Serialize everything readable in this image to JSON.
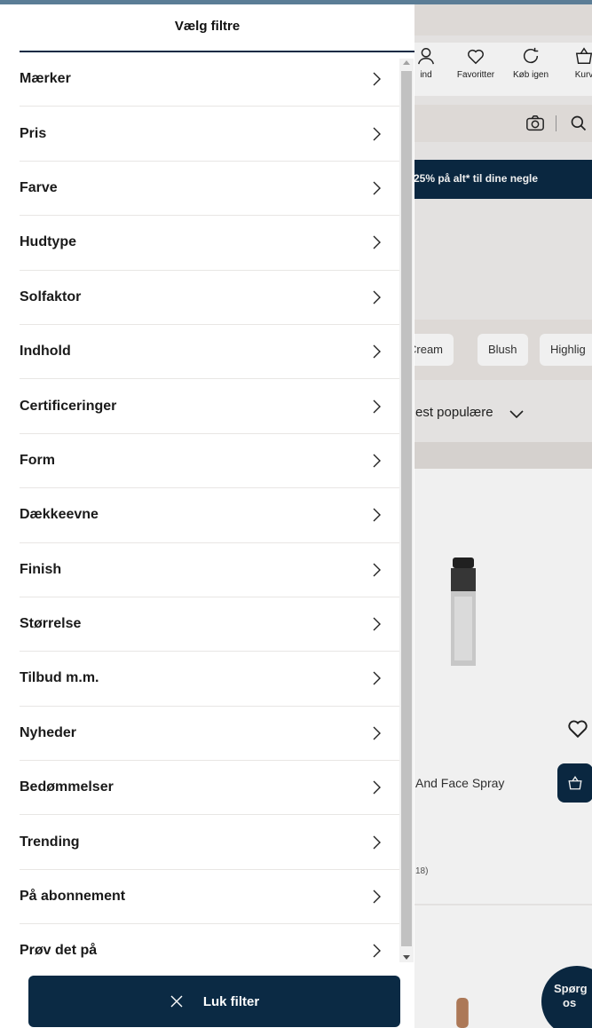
{
  "background": {
    "icons": [
      {
        "name": "account-icon",
        "label": "ind"
      },
      {
        "name": "heart-icon",
        "label": "Favoritter"
      },
      {
        "name": "reorder-icon",
        "label": "Køb igen"
      },
      {
        "name": "basket-icon",
        "label": "Kurv"
      }
    ],
    "banner_text": "25% på alt* til dine negle",
    "chips": [
      "Cream",
      "Blush",
      "Highlig"
    ],
    "sort_label": "est populære",
    "product_title": "And Face Spray",
    "product_rating": "18)",
    "chat_label_1": "Spørg",
    "chat_label_2": "os",
    "colors": {
      "navy": "#0b2a44",
      "strip": "#5b7d96"
    }
  },
  "panel": {
    "title": "Vælg filtre",
    "filters": [
      "Mærker",
      "Pris",
      "Farve",
      "Hudtype",
      "Solfaktor",
      "Indhold",
      "Certificeringer",
      "Form",
      "Dækkeevne",
      "Finish",
      "Størrelse",
      "Tilbud m.m.",
      "Nyheder",
      "Bedømmelser",
      "Trending",
      "På abonnement",
      "Prøv det på"
    ],
    "close_label": "Luk filter"
  }
}
